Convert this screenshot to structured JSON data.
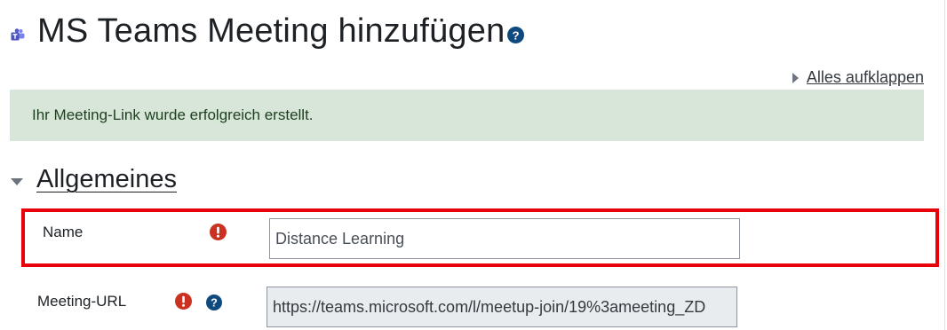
{
  "header": {
    "title": "MS Teams Meeting hinzufügen",
    "icon": "ms-teams-icon",
    "help_icon": "help-circle-icon"
  },
  "expand_all": {
    "label": "Alles aufklappen"
  },
  "alert": {
    "message": "Ihr Meeting-Link wurde erfolgreich erstellt.",
    "bg_color": "#d7e6d8"
  },
  "section": {
    "title": "Allgemeines"
  },
  "form": {
    "name": {
      "label": "Name",
      "value": "Distance Learning",
      "required": true
    },
    "meeting_url": {
      "label": "Meeting-URL",
      "value": "https://teams.microsoft.com/l/meetup-join/19%3ameeting_ZD",
      "required": true,
      "readonly": true
    }
  },
  "colors": {
    "highlight": "#e8000b",
    "required": "#ca3120",
    "help": "#0f6cbf",
    "accent": "#5059c9"
  }
}
